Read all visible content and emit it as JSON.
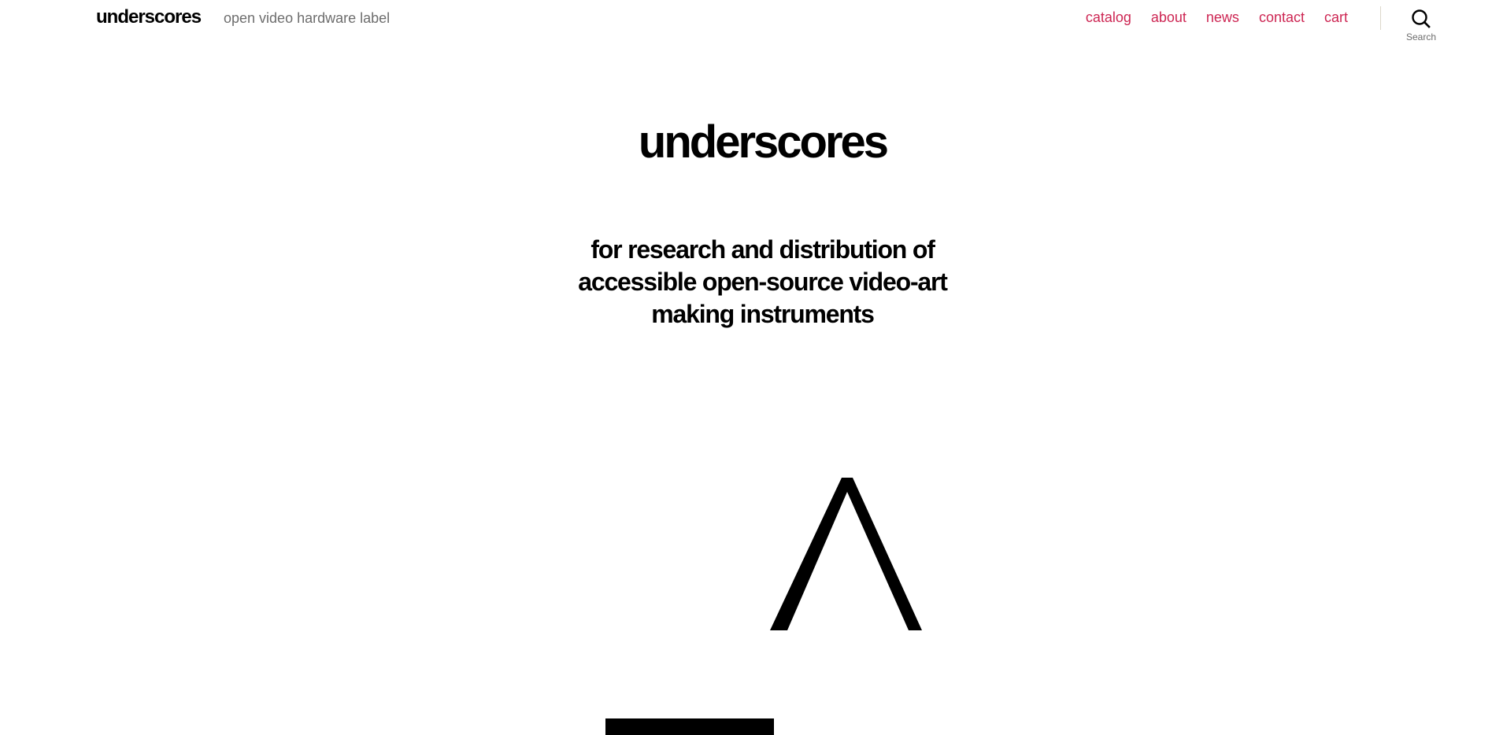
{
  "header": {
    "site_title": "underscores",
    "site_description": "open video hardware label",
    "nav": [
      "catalog",
      "about",
      "news",
      "contact",
      "cart"
    ],
    "search_label": "Search",
    "link_color": "#cd2653"
  },
  "hero": {
    "title": "underscores",
    "text": "for research and distribution of accessible open-source video-art making instruments"
  },
  "icons": {
    "search": "search-icon",
    "artwork": [
      "caret-shape",
      "underscore-bar"
    ]
  }
}
